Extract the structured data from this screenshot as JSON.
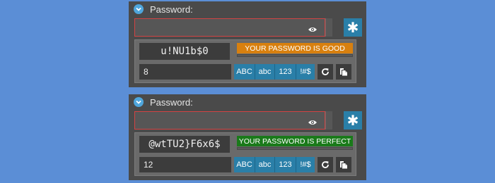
{
  "colors": {
    "background": "#5b8ed6",
    "widget_background": "#4a4a4a",
    "accent_blue": "#2a7fa8",
    "field_border_error": "#d24343",
    "strength_good": "#d8800f",
    "strength_perfect": "#1a7a1a"
  },
  "widgets": [
    {
      "header_label": "Password:",
      "password_value": "",
      "generate_button_icon": "asterisk-icon",
      "generated_password": "u!NU1b$0",
      "strength_text": "YOUR PASSWORD IS GOOD",
      "strength_color": "#d8800f",
      "strength_level": 0.0,
      "length_value": "8",
      "charsets": {
        "upper": "ABC",
        "lower": "abc",
        "digits": "123",
        "symbols": "!#$"
      },
      "regenerate_icon": "refresh-icon",
      "copy_icon": "copy-icon"
    },
    {
      "header_label": "Password:",
      "password_value": "",
      "generate_button_icon": "asterisk-icon",
      "generated_password": "@wtTU2}F6x6$",
      "strength_text": "YOUR PASSWORD IS PERFECT",
      "strength_color": "#1a7a1a",
      "strength_level": 0.0,
      "length_value": "12",
      "charsets": {
        "upper": "ABC",
        "lower": "abc",
        "digits": "123",
        "symbols": "!#$"
      },
      "regenerate_icon": "refresh-icon",
      "copy_icon": "copy-icon"
    }
  ]
}
